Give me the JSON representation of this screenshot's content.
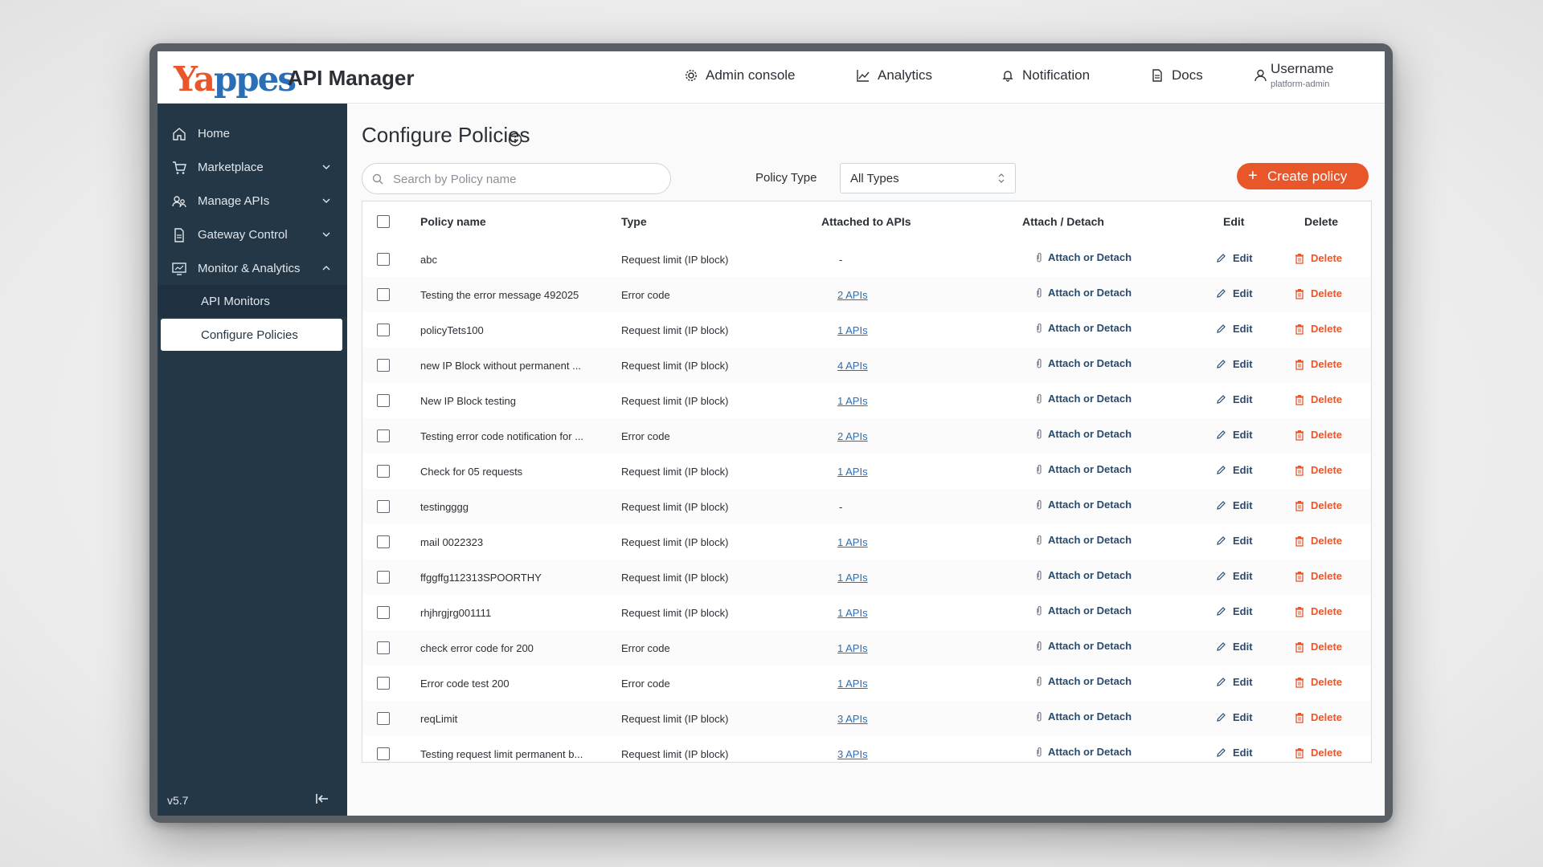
{
  "header": {
    "logo_text_part1": "Ya",
    "logo_text_part2": "ppes",
    "brand": "API Manager",
    "nav": [
      {
        "label": "Admin console",
        "icon": "gear-icon"
      },
      {
        "label": "Analytics",
        "icon": "chart-icon"
      },
      {
        "label": "Notification",
        "icon": "bell-icon"
      },
      {
        "label": "Docs",
        "icon": "document-icon"
      }
    ],
    "user": {
      "name": "Username",
      "role": "platform-admin"
    }
  },
  "sidebar": {
    "items": [
      {
        "label": "Home",
        "icon": "home-icon"
      },
      {
        "label": "Marketplace",
        "icon": "cart-icon"
      },
      {
        "label": "Manage APIs",
        "icon": "users-icon"
      },
      {
        "label": "Gateway Control",
        "icon": "document-icon"
      },
      {
        "label": "Monitor & Analytics",
        "icon": "monitor-icon"
      }
    ],
    "sub_items": [
      {
        "label": "API Monitors"
      },
      {
        "label": "Configure Policies"
      }
    ],
    "version": "v5.7"
  },
  "main": {
    "title": "Configure Policies",
    "search_placeholder": "Search by Policy name",
    "policy_type_label": "Policy Type",
    "policy_type_value": "All Types",
    "create_label": "Create policy",
    "columns": [
      "Policy name",
      "Type",
      "Attached to APIs",
      "Attach / Detach",
      "Edit",
      "Delete"
    ],
    "attach_label": "Attach or Detach",
    "edit_label": "Edit",
    "delete_label": "Delete",
    "rows": [
      {
        "name": "abc",
        "type": "Request limit (IP block)",
        "apis": "-"
      },
      {
        "name": "Testing the error message 492025",
        "type": "Error code",
        "apis": "2 APIs"
      },
      {
        "name": "policyTets100",
        "type": "Request limit (IP block)",
        "apis": "1 APIs"
      },
      {
        "name": "new IP Block without permanent ...",
        "type": "Request limit (IP block)",
        "apis": "4 APIs"
      },
      {
        "name": "New IP Block testing",
        "type": "Request limit (IP block)",
        "apis": "1 APIs"
      },
      {
        "name": "Testing error code notification for ...",
        "type": "Error code",
        "apis": "2 APIs"
      },
      {
        "name": "Check for 05 requests",
        "type": "Request limit (IP block)",
        "apis": "1 APIs"
      },
      {
        "name": "testingggg",
        "type": "Request limit (IP block)",
        "apis": "-"
      },
      {
        "name": "mail 0022323",
        "type": "Request limit (IP block)",
        "apis": "1 APIs"
      },
      {
        "name": "ffggffg112313SPOORTHY",
        "type": "Request limit (IP block)",
        "apis": "1 APIs"
      },
      {
        "name": "rhjhrgjrg001111",
        "type": "Request limit (IP block)",
        "apis": "1 APIs"
      },
      {
        "name": "check error code for 200",
        "type": "Error code",
        "apis": "1 APIs"
      },
      {
        "name": "Error code test 200",
        "type": "Error code",
        "apis": "1 APIs"
      },
      {
        "name": "reqLimit",
        "type": "Request limit (IP block)",
        "apis": "3 APIs"
      },
      {
        "name": "Testing request limit permanent b...",
        "type": "Request limit (IP block)",
        "apis": "3 APIs"
      }
    ]
  },
  "colors": {
    "accent": "#e8562a",
    "sidebar": "#243746",
    "link": "#2a6fb5"
  }
}
